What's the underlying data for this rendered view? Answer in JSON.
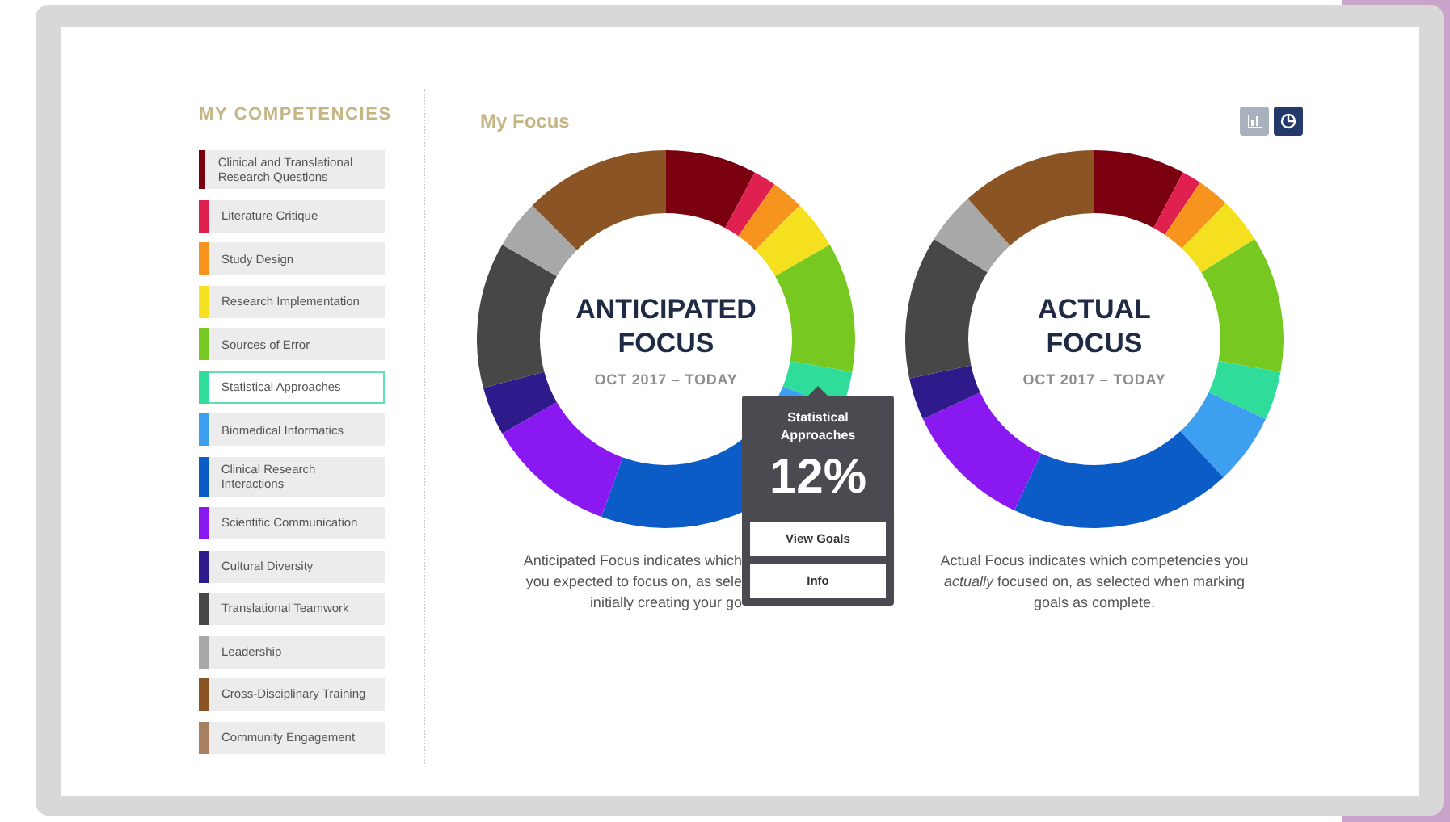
{
  "sidebar": {
    "title": "MY COMPETENCIES",
    "items": [
      {
        "label": "Clinical and Translational Research Questions",
        "color": "#7a0010",
        "selected": false
      },
      {
        "label": "Literature Critique",
        "color": "#e0204f",
        "selected": false
      },
      {
        "label": "Study Design",
        "color": "#f7941d",
        "selected": false
      },
      {
        "label": "Research Implementation",
        "color": "#f5e01f",
        "selected": false
      },
      {
        "label": "Sources of Error",
        "color": "#77c921",
        "selected": false
      },
      {
        "label": "Statistical Approaches",
        "color": "#2fdc9a",
        "selected": true
      },
      {
        "label": "Biomedical Informatics",
        "color": "#3c9ff0",
        "selected": false
      },
      {
        "label": "Clinical Research Interactions",
        "color": "#0b5cc7",
        "selected": false
      },
      {
        "label": "Scientific Communication",
        "color": "#8a18f0",
        "selected": false
      },
      {
        "label": "Cultural Diversity",
        "color": "#2f1a8c",
        "selected": false
      },
      {
        "label": "Translational Teamwork",
        "color": "#474747",
        "selected": false
      },
      {
        "label": "Leadership",
        "color": "#a8a8a8",
        "selected": false
      },
      {
        "label": "Cross-Disciplinary Training",
        "color": "#8b5425",
        "selected": false
      },
      {
        "label": "Community Engagement",
        "color": "#a9805f",
        "selected": false
      }
    ]
  },
  "main": {
    "title": "My Focus",
    "view_toggle": [
      {
        "kind": "bar",
        "selected": false
      },
      {
        "kind": "pie",
        "selected": true
      }
    ],
    "charts": [
      {
        "title": "ANTICIPATED FOCUS",
        "period": "OCT 2017 – TODAY",
        "caption_lines": [
          "Anticipated Focus indicates which",
          "you expected to focus on, as sele",
          "initially creating your go"
        ],
        "tooltip": {
          "title": "Statistical Approaches",
          "value": "12%",
          "buttons": [
            "View Goals",
            "Info"
          ]
        }
      },
      {
        "title": "ACTUAL FOCUS",
        "period": "OCT 2017 – TODAY",
        "caption": "Actual Focus indicates which competencies you *actually* focused on, as selected when marking goals as complete."
      }
    ]
  }
}
